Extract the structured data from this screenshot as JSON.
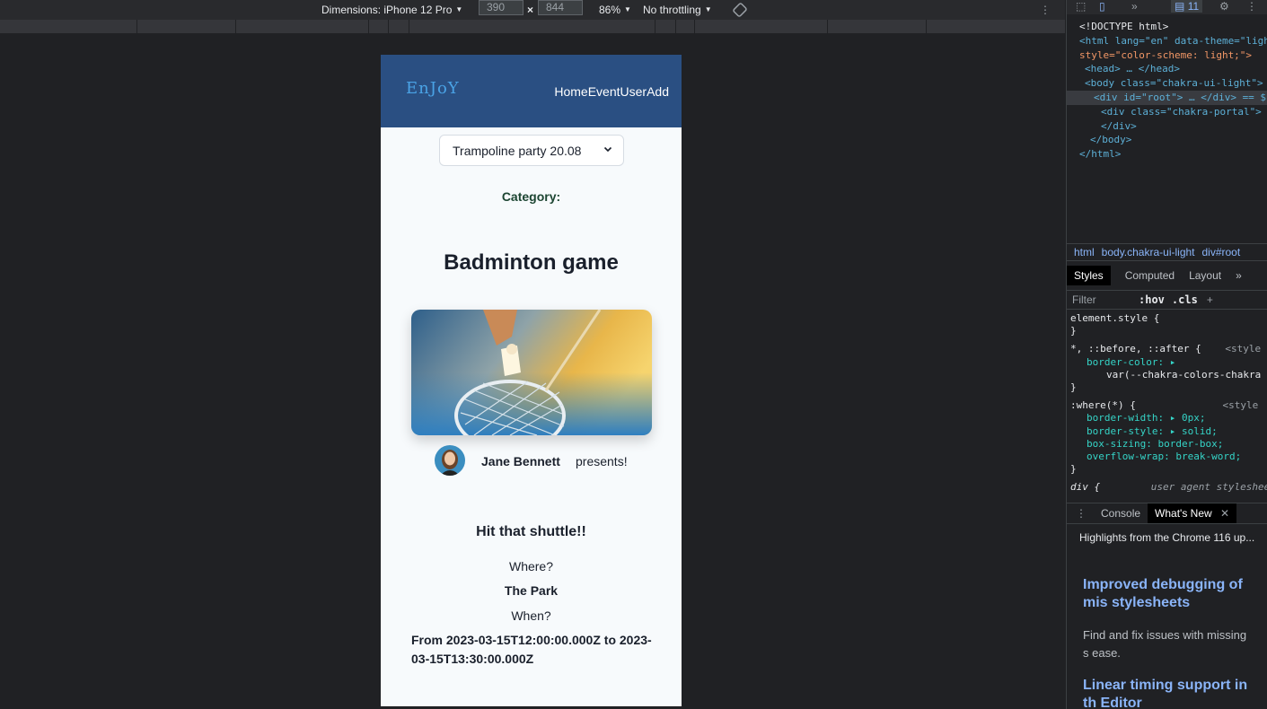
{
  "toolbar": {
    "dimensions_label": "Dimensions: iPhone 12 Pro",
    "width_value": "390",
    "times_symbol": "×",
    "height_value": "844",
    "zoom_label": "86%",
    "throttle_label": "No throttling"
  },
  "app": {
    "logo": "EnJoY",
    "nav": [
      "Home",
      "Event",
      "User",
      "Add"
    ],
    "event_select": "Trampoline party 20.08",
    "category_label": "Category:",
    "event_title": "Badminton game",
    "presenter_name": "Jane Bennett",
    "presents_text": "presents!",
    "description": "Hit that shuttle!!",
    "where_label": "Where?",
    "location": "The Park",
    "when_label": "When?",
    "time_range": "From 2023-03-15T12:00:00.000Z to 2023-03-15T13:30:00.000Z"
  },
  "devtools": {
    "issues_count": "11",
    "dom_lines": [
      "<!DOCTYPE html>",
      "<html lang=\"en\" data-theme=\"ligh",
      "style=\"color-scheme: light;\">",
      "<head> … </head>",
      "<body class=\"chakra-ui-light\">",
      "<div id=\"root\"> … </div> == $",
      "<div class=\"chakra-portal\">",
      "</div>",
      "</body>",
      "</html>"
    ],
    "breadcrumbs": [
      "html",
      "body.chakra-ui-light",
      "div#root"
    ],
    "tabs": [
      "Styles",
      "Computed",
      "Layout"
    ],
    "filter_placeholder": "Filter",
    "hov": ":hov",
    "cls": ".cls",
    "styles_lines": [
      "element.style {",
      "}",
      "*, ::before, ::after {",
      "border-color: ▸",
      "var(--chakra-colors-chakra",
      "}",
      ":where(*) {",
      "border-width: ▸ 0px;",
      "border-style: ▸ solid;",
      "box-sizing: border-box;",
      "overflow-wrap: break-word;",
      "}",
      "div {"
    ],
    "style_source": "<style",
    "ua_source": "user agent styleshee",
    "drawer_tabs": [
      "Console",
      "What's New"
    ],
    "whatsnew_title": "Highlights from the Chrome 116 up...",
    "wn_heading1": "Improved debugging of mis stylesheets",
    "wn_text1": "Find and fix issues with missing s ease.",
    "wn_heading2": "Linear timing support in th Editor"
  },
  "colors": {
    "header_bg": "#2a4f82",
    "logo": "#4aa3e6",
    "page_bg": "#f7fafc",
    "category_text": "#1c4532"
  }
}
